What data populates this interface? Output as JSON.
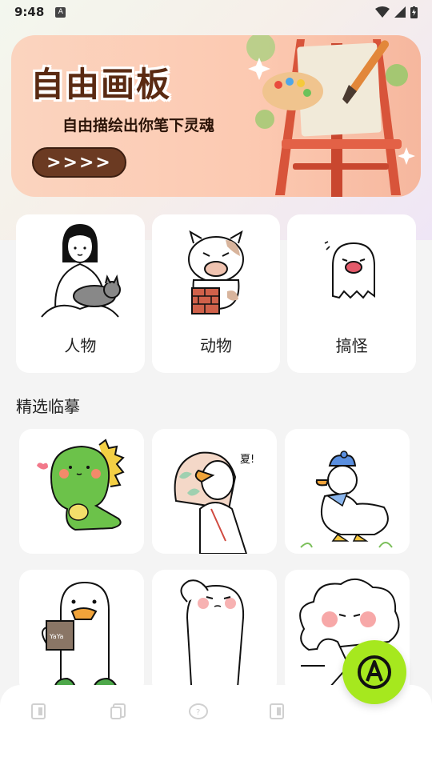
{
  "status_bar": {
    "time": "9:48",
    "notification_letter": "A"
  },
  "banner": {
    "title": "自由画板",
    "subtitle": "自由描绘出你笔下灵魂",
    "button_label": ">>>>"
  },
  "categories": [
    {
      "label": "人物",
      "icon": "girl-with-cat-illustration"
    },
    {
      "label": "动物",
      "icon": "cow-on-bricks-illustration"
    },
    {
      "label": "搞怪",
      "icon": "ghost-illustration"
    }
  ],
  "section": {
    "title": "精选临摹"
  },
  "featured": [
    {
      "icon": "green-dinosaur-illustration"
    },
    {
      "icon": "duck-with-scarf-illustration"
    },
    {
      "icon": "duck-with-blue-hat-illustration"
    },
    {
      "icon": "duck-holding-cup-illustration",
      "cup_text": "YaYa"
    },
    {
      "icon": "saluting-character-illustration"
    },
    {
      "icon": "cloud-character-illustration"
    }
  ],
  "bottom_nav": {
    "items": [
      "home-icon",
      "copy-icon",
      "palette-icon",
      "profile-icon"
    ]
  },
  "colors": {
    "fab": "#a6e81e",
    "banner_button": "#6b3a22",
    "banner_bg": "#fcc9b1"
  }
}
